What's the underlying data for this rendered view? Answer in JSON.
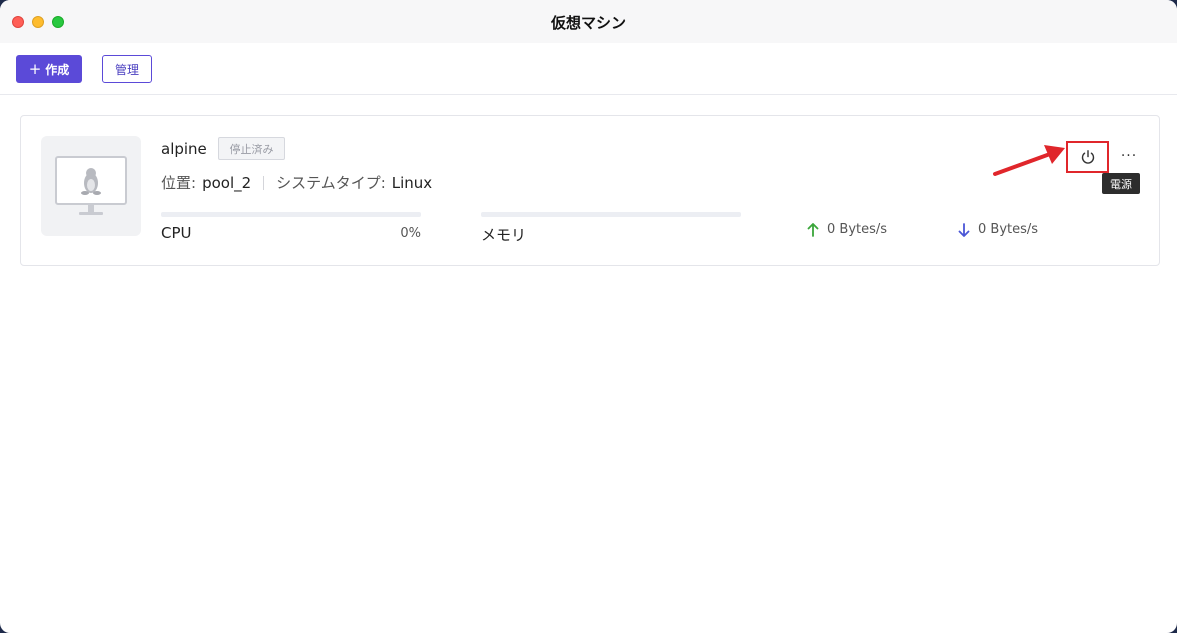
{
  "window": {
    "title": "仮想マシン"
  },
  "toolbar": {
    "create_label": "作成",
    "manage_label": "管理"
  },
  "vm": {
    "name": "alpine",
    "status": "停止済み",
    "location_label": "位置:",
    "location_value": "pool_2",
    "system_type_label": "システムタイプ:",
    "system_type_value": "Linux",
    "cpu_label": "CPU",
    "cpu_percent": "0%",
    "cpu_fraction": 0,
    "memory_label": "メモリ",
    "memory_fraction": 0,
    "upload_rate": "0 Bytes/s",
    "download_rate": "0 Bytes/s",
    "power_tooltip": "電源"
  },
  "colors": {
    "accent": "#5b4ad8",
    "highlight": "#e0262b",
    "upload": "#3aa63a",
    "download": "#4a56d6"
  },
  "icons": [
    "plus-icon",
    "linux-monitor-icon",
    "power-icon",
    "more-icon",
    "arrow-up-icon",
    "arrow-down-icon"
  ]
}
